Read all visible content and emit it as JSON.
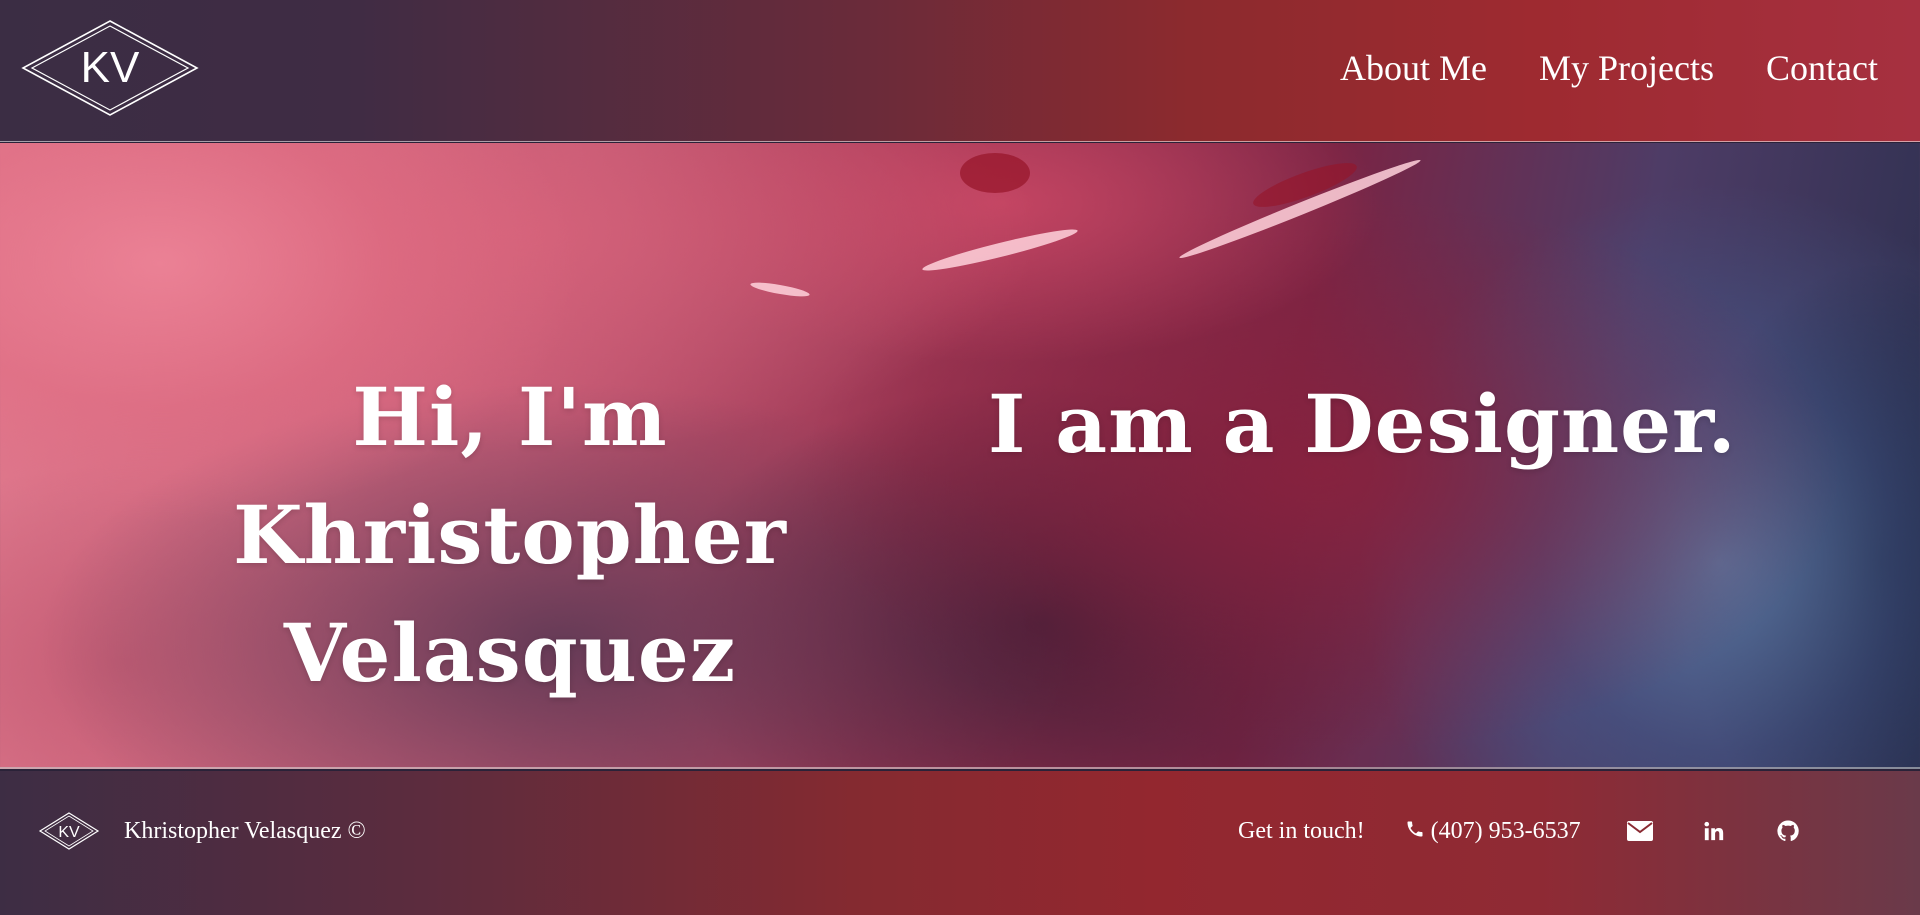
{
  "header": {
    "logo_text": "KV",
    "nav": [
      {
        "label": "About Me"
      },
      {
        "label": "My Projects"
      },
      {
        "label": "Contact"
      }
    ]
  },
  "hero": {
    "greeting_line1": "Hi, I'm Khristopher",
    "greeting_line2": "Velasquez",
    "role_text": "I am a Designer."
  },
  "footer": {
    "logo_text": "KV",
    "copyright": "Khristopher Velasquez ©",
    "get_in_touch": "Get in touch!",
    "phone": "(407) 953-6537",
    "icons": [
      "phone-icon",
      "envelope-icon",
      "linkedin-icon",
      "github-icon"
    ]
  },
  "colors": {
    "header_left": "#3b2d44",
    "header_right": "#a63040",
    "text": "#ffffff"
  }
}
